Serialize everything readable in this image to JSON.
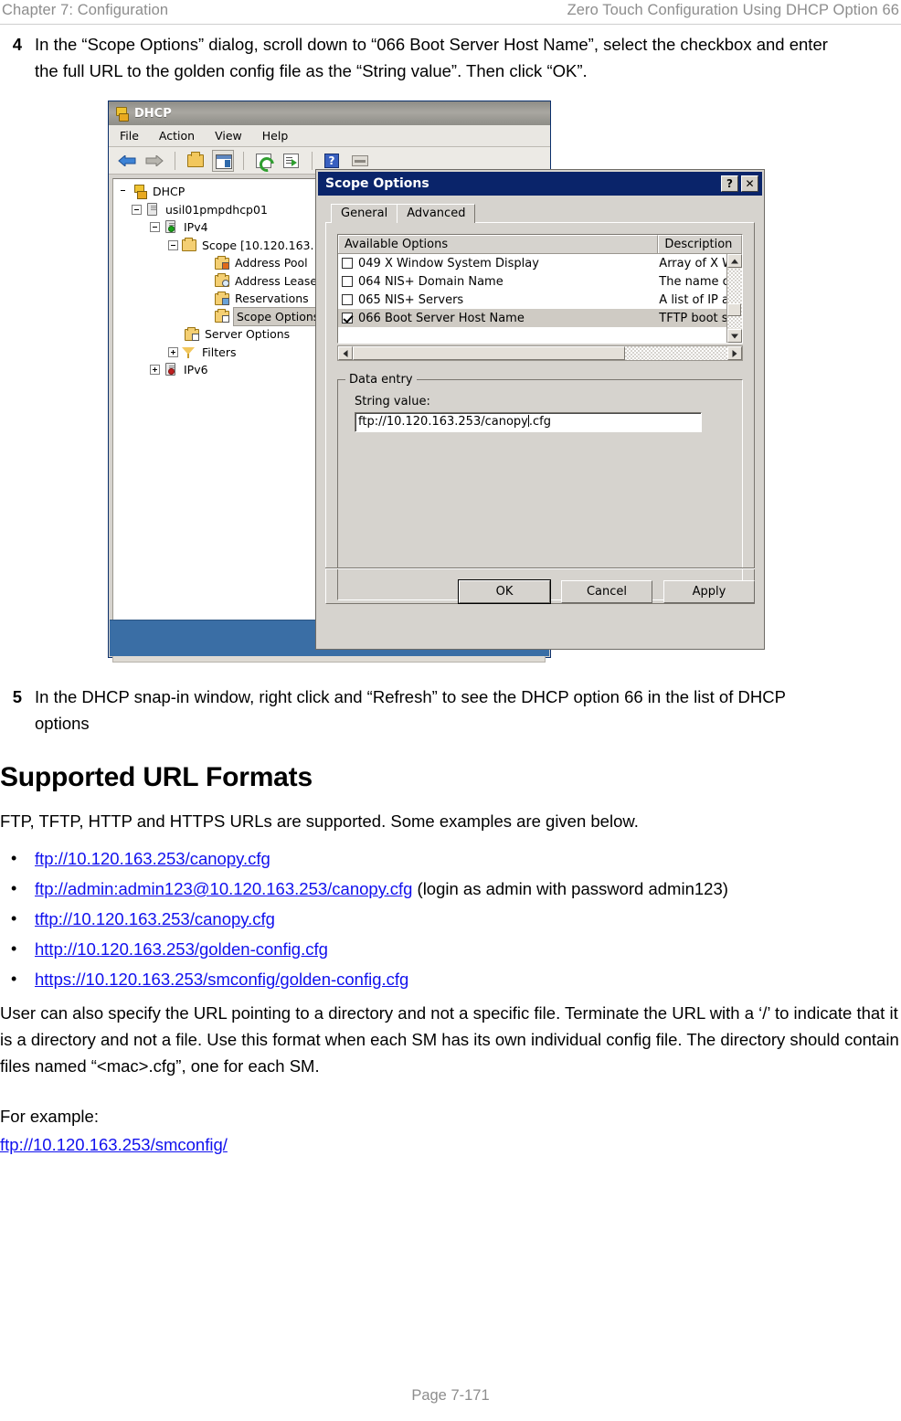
{
  "header": {
    "left": "Chapter 7:  Configuration",
    "right": "Zero Touch Configuration Using DHCP Option 66"
  },
  "footer": {
    "page": "Page 7-171"
  },
  "steps": [
    {
      "number": "4",
      "text": "In the “Scope Options” dialog, scroll down to “066 Boot Server Host Name”, select the checkbox and enter the full URL to the golden config file as the “String value”. Then click “OK”."
    },
    {
      "number": "5",
      "text": "In the DHCP snap-in window, right click and “Refresh” to see the DHCP option 66 in the list of DHCP options"
    }
  ],
  "section": {
    "heading": "Supported URL Formats",
    "intro": "FTP, TFTP, HTTP and HTTPS URLs are supported. Some examples are given below.",
    "urls": [
      {
        "link": "ftp://10.120.163.253/canopy.cfg",
        "note": ""
      },
      {
        "link": "ftp://admin:admin123@10.120.163.253/canopy.cfg",
        "note": "  (login as admin with password admin123)"
      },
      {
        "link": "tftp://10.120.163.253/canopy.cfg",
        "note": ""
      },
      {
        "link": "http://10.120.163.253/golden-config.cfg",
        "note": ""
      },
      {
        "link": "https://10.120.163.253/smconfig/golden-config.cfg",
        "note": ""
      }
    ],
    "paragraph": "User can also specify the URL pointing to a directory and not a specific file. Terminate the URL with a ‘/’ to indicate that it is a directory and not a file. Use this format when each SM has its own individual config file. The directory should contain files named “<mac>.cfg”, one for each SM.",
    "example_label": "For example:",
    "example_link": "ftp://10.120.163.253/smconfig/"
  },
  "screenshot": {
    "mmc": {
      "title": "DHCP",
      "menu": [
        "File",
        "Action",
        "View",
        "Help"
      ],
      "toolbar_icons": [
        "back-arrow-icon",
        "forward-arrow-icon",
        "folder-up-icon",
        "show-hide-tree-icon",
        "refresh-icon",
        "export-list-icon",
        "help-icon",
        "properties-icon"
      ],
      "tree": [
        {
          "label": "DHCP",
          "indent": 0,
          "expander": "none",
          "icon": "dhcp-root-icon",
          "selected": false
        },
        {
          "label": "usil01pmpdhcp01",
          "indent": 1,
          "expander": "minus",
          "icon": "server-icon",
          "selected": false
        },
        {
          "label": "IPv4",
          "indent": 2,
          "expander": "minus",
          "icon": "server-green-icon",
          "selected": false
        },
        {
          "label": "Scope [10.120.163.",
          "indent": 3,
          "expander": "minus",
          "icon": "folder-icon",
          "selected": false
        },
        {
          "label": "Address Pool",
          "indent": 4,
          "expander": "none",
          "icon": "address-pool-folder-icon",
          "selected": false
        },
        {
          "label": "Address Leases",
          "indent": 4,
          "expander": "none",
          "icon": "address-leases-folder-icon",
          "selected": false
        },
        {
          "label": "Reservations",
          "indent": 4,
          "expander": "none",
          "icon": "reservations-folder-icon",
          "selected": false
        },
        {
          "label": "Scope Options",
          "indent": 4,
          "expander": "none",
          "icon": "scope-options-folder-icon",
          "selected": true
        },
        {
          "label": "Server Options",
          "indent": 3,
          "expander": "none",
          "icon": "server-options-folder-icon",
          "selected": false
        },
        {
          "label": "Filters",
          "indent": 3,
          "expander": "plus",
          "icon": "filter-funnel-icon",
          "selected": false
        },
        {
          "label": "IPv6",
          "indent": 2,
          "expander": "plus",
          "icon": "server-red-icon",
          "selected": false
        }
      ]
    },
    "dialog": {
      "title": "Scope Options",
      "help_button": "?",
      "close_button": "✕",
      "tabs": [
        {
          "label": "General",
          "active": true
        },
        {
          "label": "Advanced",
          "active": false
        }
      ],
      "list": {
        "columns": [
          "Available Options",
          "Description"
        ],
        "rows": [
          {
            "checked": false,
            "name": "049 X Window System Display",
            "desc": "Array of X W",
            "selected": false
          },
          {
            "checked": false,
            "name": "064 NIS+ Domain Name",
            "desc": "The name o",
            "selected": false
          },
          {
            "checked": false,
            "name": "065 NIS+ Servers",
            "desc": "A list of IP a",
            "selected": false
          },
          {
            "checked": true,
            "name": "066 Boot Server Host Name",
            "desc": "TFTP boot s",
            "selected": true
          }
        ]
      },
      "data_entry": {
        "legend": "Data entry",
        "field_label": "String value:",
        "value_before_caret": "ftp://10.120.163.253/canopy",
        "value_after_caret": ".cfg"
      },
      "buttons": [
        {
          "label": "OK",
          "default": true
        },
        {
          "label": "Cancel",
          "default": false
        },
        {
          "label": "Apply",
          "default": false
        }
      ]
    }
  }
}
